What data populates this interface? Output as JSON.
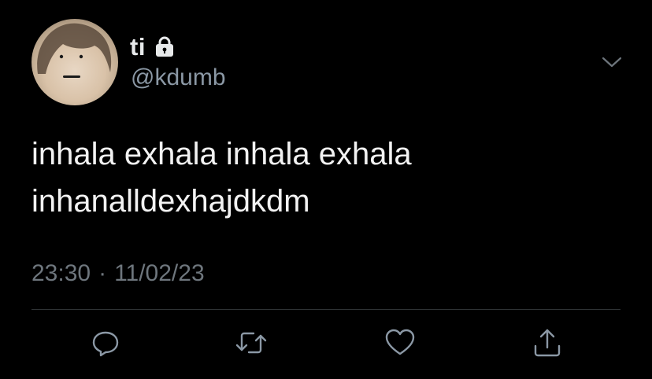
{
  "tweet": {
    "display_name": "ti",
    "handle": "@kdumb",
    "text_lines": [
      "inhala exhala inhala exhala",
      "inhanalldexhajdkdm"
    ],
    "time": "23:30",
    "separator": "·",
    "date": "11/02/23"
  },
  "icons": {
    "lock": "lock-icon",
    "menu": "chevron-down-icon",
    "reply": "reply-icon",
    "retweet": "retweet-icon",
    "like": "heart-icon",
    "share": "share-icon"
  },
  "colors": {
    "background": "#000000",
    "primary_text": "#e7e9ea",
    "secondary_text": "#8b98a5",
    "timestamp_text": "#6e767d",
    "divider": "#2f3336",
    "icon": "#8b98a5"
  }
}
